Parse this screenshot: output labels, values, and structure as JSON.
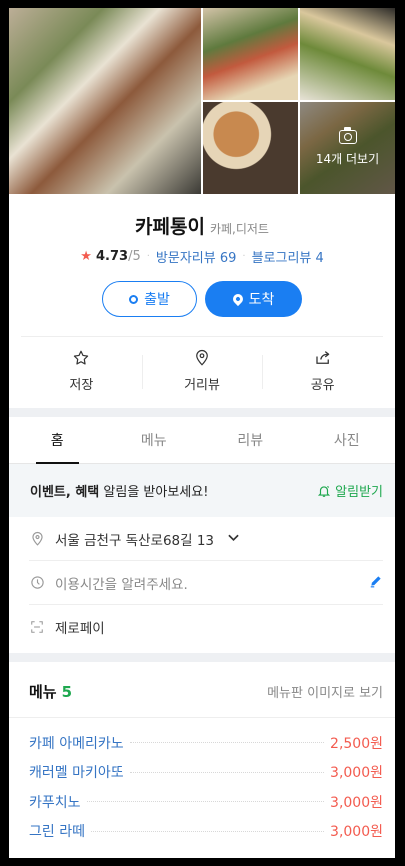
{
  "photos": {
    "more_label": "14개 더보기"
  },
  "place": {
    "name": "카페통이",
    "category": "카페,디저트",
    "rating": "4.73",
    "rating_max": "/5",
    "visitor_reviews_label": "방문자리뷰 69",
    "blog_reviews_label": "블로그리뷰 4"
  },
  "buttons": {
    "start": "출발",
    "arrive": "도착"
  },
  "actions": {
    "save": "저장",
    "street_view": "거리뷰",
    "share": "공유"
  },
  "tabs": [
    "홈",
    "메뉴",
    "리뷰",
    "사진"
  ],
  "notify": {
    "bold": "이벤트, 혜택",
    "text": " 알림을 받아보세요!",
    "button": "알림받기"
  },
  "info": {
    "address": "서울 금천구 독산로68길 13",
    "hours_prompt": "이용시간을 알려주세요.",
    "payment": "제로페이"
  },
  "menu": {
    "title": "메뉴",
    "count": "5",
    "view_image_link": "메뉴판 이미지로 보기",
    "items": [
      {
        "name": "카페 아메리카노",
        "price": "2,500원"
      },
      {
        "name": "캐러멜 마키아또",
        "price": "3,000원"
      },
      {
        "name": "카푸치노",
        "price": "3,000원"
      },
      {
        "name": "그린 라떼",
        "price": "3,000원"
      }
    ]
  },
  "colors": {
    "accent_blue": "#1a7ef2",
    "green": "#1fa84f",
    "price_red": "#f35b4f",
    "link_blue": "#3675c4"
  }
}
